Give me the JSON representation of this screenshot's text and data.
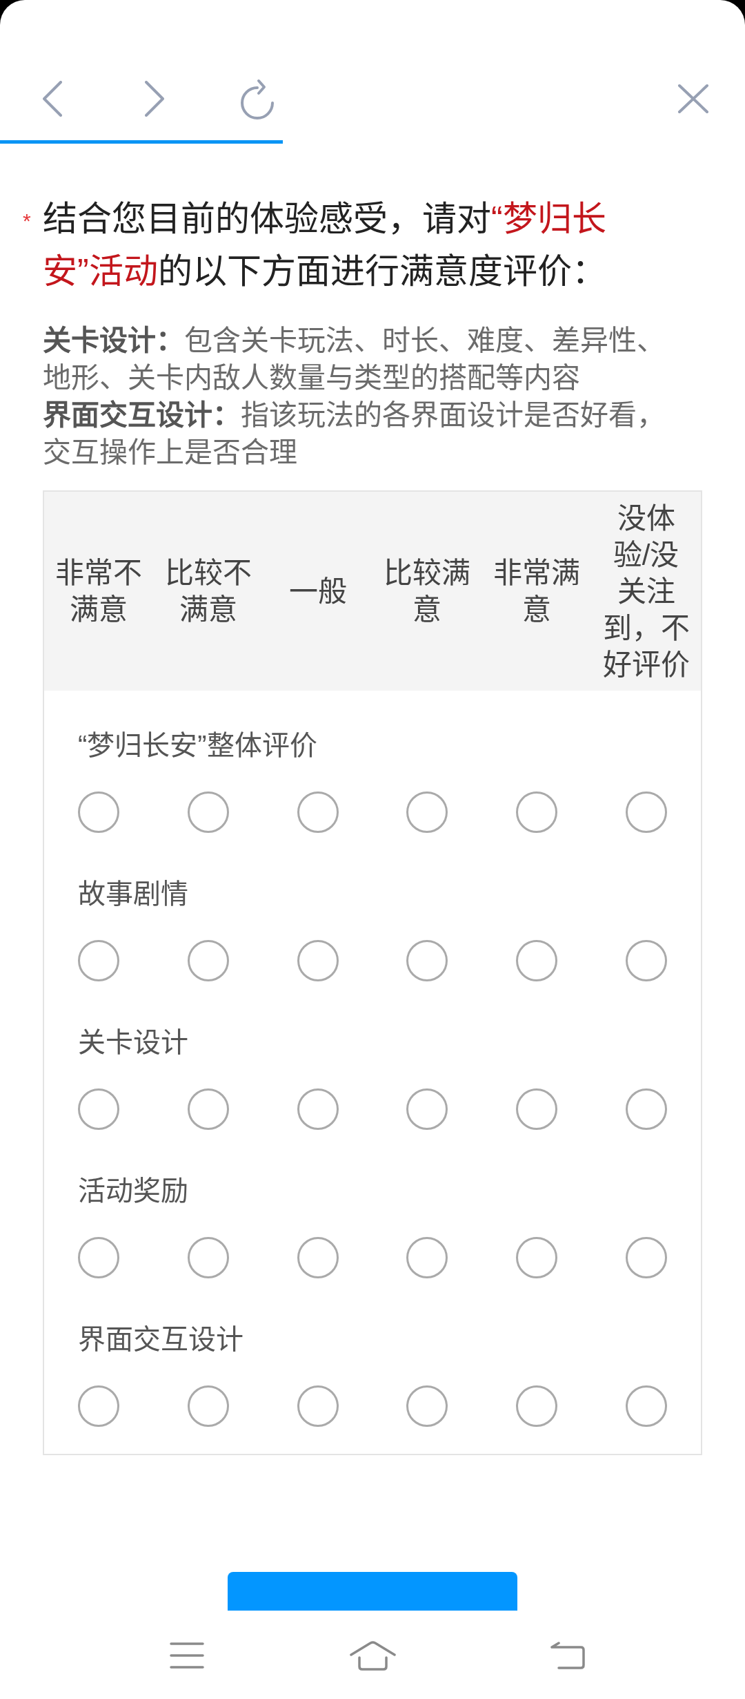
{
  "browser_bar": {
    "progress": {
      "level": 0.38
    }
  },
  "question": {
    "required_mark": "*",
    "title": [
      {
        "text": "结合您目前的体验感受，请对",
        "highlight": false
      },
      {
        "text": "“梦归长安”活动",
        "highlight": true
      },
      {
        "text": "的以下方面进行满意度评价：",
        "highlight": false
      }
    ],
    "notes": [
      "**关卡设计：**包含关卡玩法、时长、难度、差异性、地形、关卡内敌人数量与类型的搭配等内容",
      "**界面交互设计：**指该玩法的各界面设计是否好看，交互操作上是否合理"
    ]
  },
  "matrix": {
    "columns": [
      "非常不满意",
      "比较不满意",
      "一般",
      "比较满意",
      "非常满意",
      "没体验/没关注到，不好评价"
    ],
    "rows": [
      {
        "label": "“梦归长安”整体评价",
        "options": [
          {
            "selected": false
          },
          {
            "selected": false
          },
          {
            "selected": false
          },
          {
            "selected": false
          },
          {
            "selected": false
          },
          {
            "selected": false
          }
        ]
      },
      {
        "label": "故事剧情",
        "options": [
          {
            "selected": false
          },
          {
            "selected": false
          },
          {
            "selected": false
          },
          {
            "selected": false
          },
          {
            "selected": false
          },
          {
            "selected": false
          }
        ]
      },
      {
        "label": "关卡设计",
        "options": [
          {
            "selected": false
          },
          {
            "selected": false
          },
          {
            "selected": false
          },
          {
            "selected": false
          },
          {
            "selected": false
          },
          {
            "selected": false
          }
        ]
      },
      {
        "label": "活动奖励",
        "options": [
          {
            "selected": false
          },
          {
            "selected": false
          },
          {
            "selected": false
          },
          {
            "selected": false
          },
          {
            "selected": false
          },
          {
            "selected": false
          }
        ]
      },
      {
        "label": "界面交互设计",
        "options": [
          {
            "selected": false
          },
          {
            "selected": false
          },
          {
            "selected": false
          },
          {
            "selected": false
          },
          {
            "selected": false
          },
          {
            "selected": false
          }
        ]
      }
    ]
  }
}
